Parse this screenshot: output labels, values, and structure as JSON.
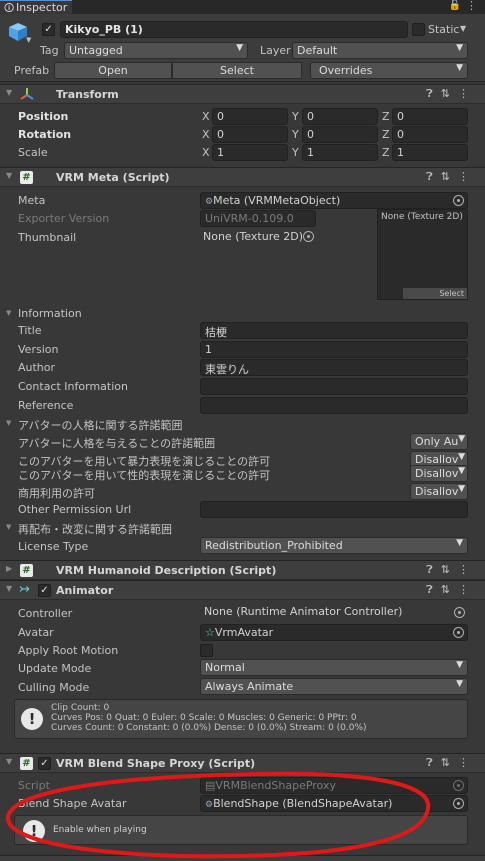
{
  "tab": {
    "title": "Inspector"
  },
  "object": {
    "name": "Kikyo_PB (1)",
    "static_label": "Static",
    "tag_label": "Tag",
    "tag_value": "Untagged",
    "layer_label": "Layer",
    "layer_value": "Default",
    "prefab_label": "Prefab",
    "open": "Open",
    "select": "Select",
    "overrides": "Overrides"
  },
  "transform": {
    "title": "Transform",
    "position": "Position",
    "rotation": "Rotation",
    "scale": "Scale",
    "pos": [
      "0",
      "0",
      "0"
    ],
    "rot": [
      "0",
      "0",
      "0"
    ],
    "scl": [
      "1",
      "1",
      "1"
    ]
  },
  "vrmmeta": {
    "title": "VRM Meta (Script)",
    "meta_label": "Meta",
    "meta_value": "Meta (VRMMetaObject)",
    "exporter_label": "Exporter Version",
    "exporter_value": "UniVRM-0.109.0",
    "thumb_label": "Thumbnail",
    "thumb_value": "None (Texture 2D)",
    "tex_label": "None (Texture 2D)",
    "tex_select": "Select",
    "info_label": "Information",
    "title_label": "Title",
    "title_value": "桔梗",
    "version_label": "Version",
    "version_value": "1",
    "author_label": "Author",
    "author_value": "東雲りん",
    "contact_label": "Contact Information",
    "reference_label": "Reference",
    "avatar_perm_label": "アバターの人格に関する許諾範囲",
    "perm1_label": "アバターに人格を与えることの許諾範囲",
    "perm1_value": "Only Au",
    "perm2_label": "このアバターを用いて暴力表現を演じることの許可",
    "perm2_value": "Disallov",
    "perm3_label": "このアバターを用いて性的表現を演じることの許可",
    "perm3_value": "Disallov",
    "perm4_label": "商用利用の許可",
    "perm4_value": "Disallov",
    "other_perm_label": "Other Permission Url",
    "redist_label": "再配布・改変に関する許諾範囲",
    "license_label": "License Type",
    "license_value": "Redistribution_Prohibited"
  },
  "humanoid": {
    "title": "VRM Humanoid Description (Script)"
  },
  "animator": {
    "title": "Animator",
    "controller_label": "Controller",
    "controller_value": "None (Runtime Animator Controller)",
    "avatar_label": "Avatar",
    "avatar_value": "VrmAvatar",
    "root_label": "Apply Root Motion",
    "update_label": "Update Mode",
    "update_value": "Normal",
    "culling_label": "Culling Mode",
    "culling_value": "Always Animate",
    "info1": "Clip Count: 0",
    "info2": "Curves Pos: 0 Quat: 0 Euler: 0 Scale: 0 Muscles: 0 Generic: 0 PPtr: 0",
    "info3": "Curves Count: 0 Constant: 0 (0.0%) Dense: 0 (0.0%) Stream: 0 (0.0%)"
  },
  "blendproxy": {
    "title": "VRM Blend Shape Proxy (Script)",
    "script_label": "Script",
    "script_value": "VRMBlendShapeProxy",
    "avatar_label": "Blend Shape Avatar",
    "avatar_value": "BlendShape (BlendShapeAvatar)",
    "help": "Enable when playing"
  },
  "colors": {
    "annotation": "#e01818",
    "background": "#383838"
  }
}
